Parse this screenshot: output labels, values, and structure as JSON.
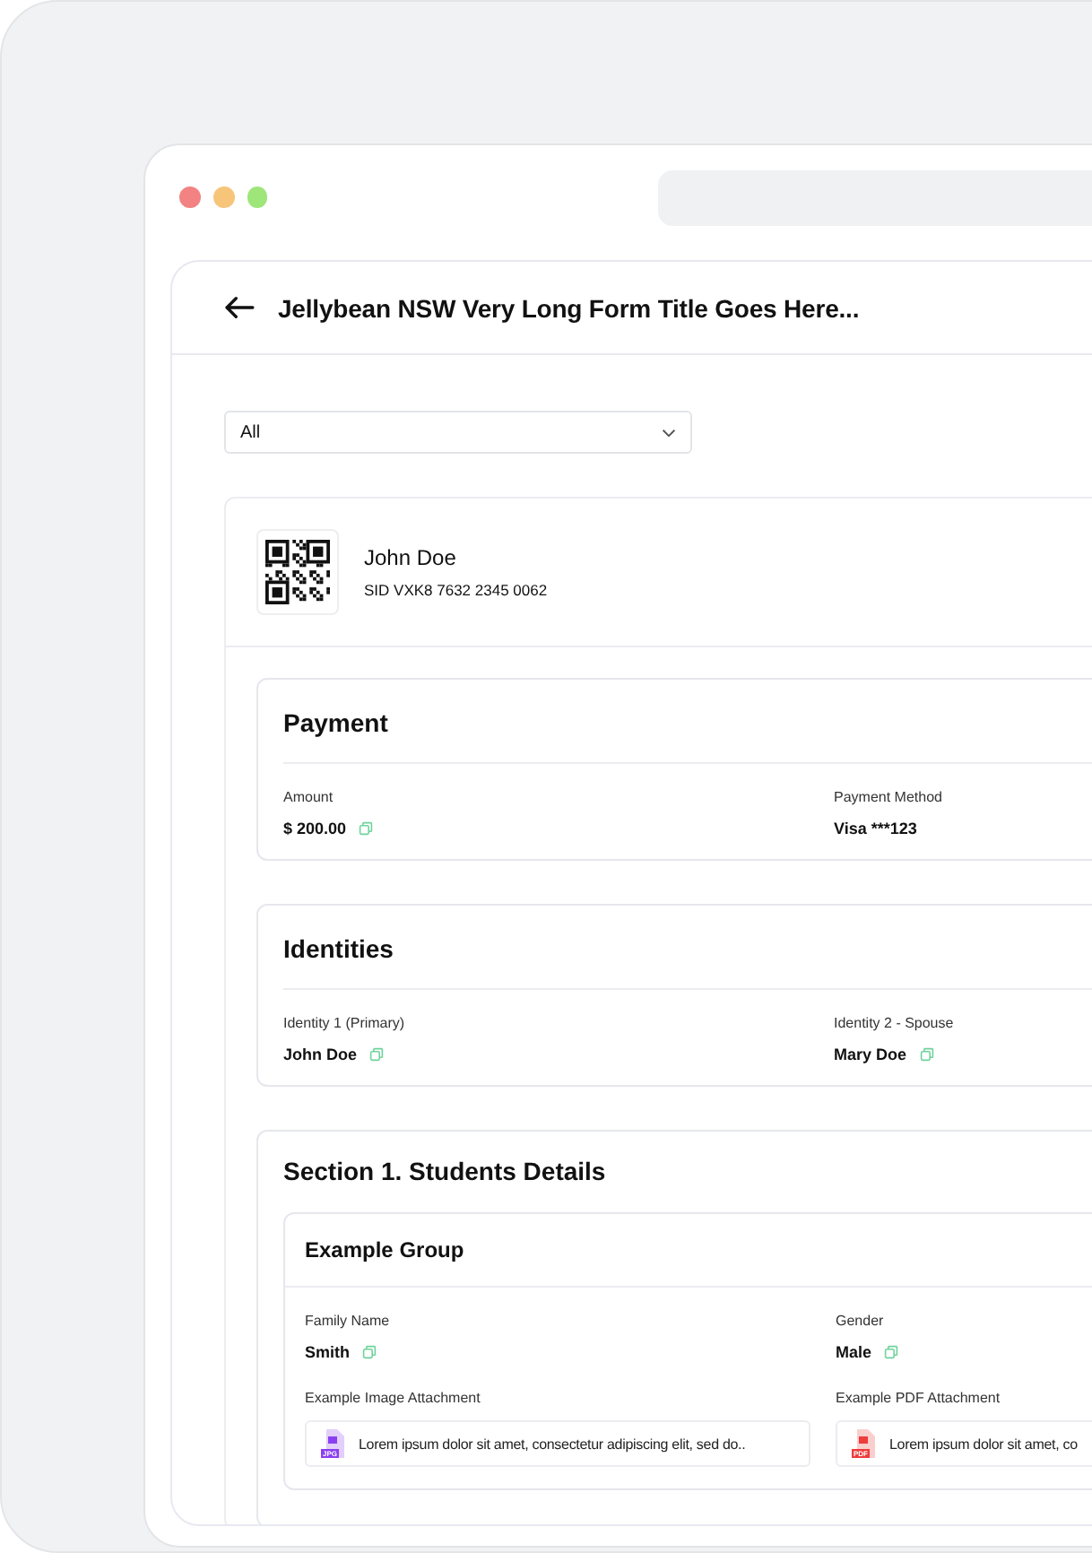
{
  "header": {
    "title": "Jellybean NSW Very Long Form Title Goes Here..."
  },
  "filter": {
    "value": "All"
  },
  "person": {
    "name": "John Doe",
    "sid": "SID VXK8 7632 2345 0062"
  },
  "cards": [
    {
      "title": "Payment",
      "fields": [
        {
          "label": "Amount",
          "value": "$ 200.00",
          "copyable": true
        },
        {
          "label": "Payment Method",
          "value": "Visa ***123",
          "copyable": false
        }
      ]
    },
    {
      "title": "Identities",
      "fields": [
        {
          "label": "Identity 1 (Primary)",
          "value": "John Doe",
          "copyable": true
        },
        {
          "label": "Identity 2 - Spouse",
          "value": "Mary Doe",
          "copyable": true
        }
      ]
    }
  ],
  "section": {
    "title": "Section 1. Students Details",
    "groups": [
      {
        "title": "Example Group",
        "fields": [
          {
            "kind": "text",
            "label": "Family Name",
            "value": "Smith",
            "copyable": true
          },
          {
            "kind": "text",
            "label": "Gender",
            "value": "Male",
            "copyable": true
          },
          {
            "kind": "attachment",
            "label": "Example Image Attachment",
            "badge": "JPG",
            "color": "#8b3ff0",
            "value": "Lorem ipsum dolor sit amet, consectetur adipiscing elit, sed do.."
          },
          {
            "kind": "attachment",
            "label": "Example PDF Attachment",
            "badge": "PDF",
            "color": "#ee3b3b",
            "value": "Lorem ipsum dolor sit amet, co"
          }
        ]
      }
    ]
  }
}
